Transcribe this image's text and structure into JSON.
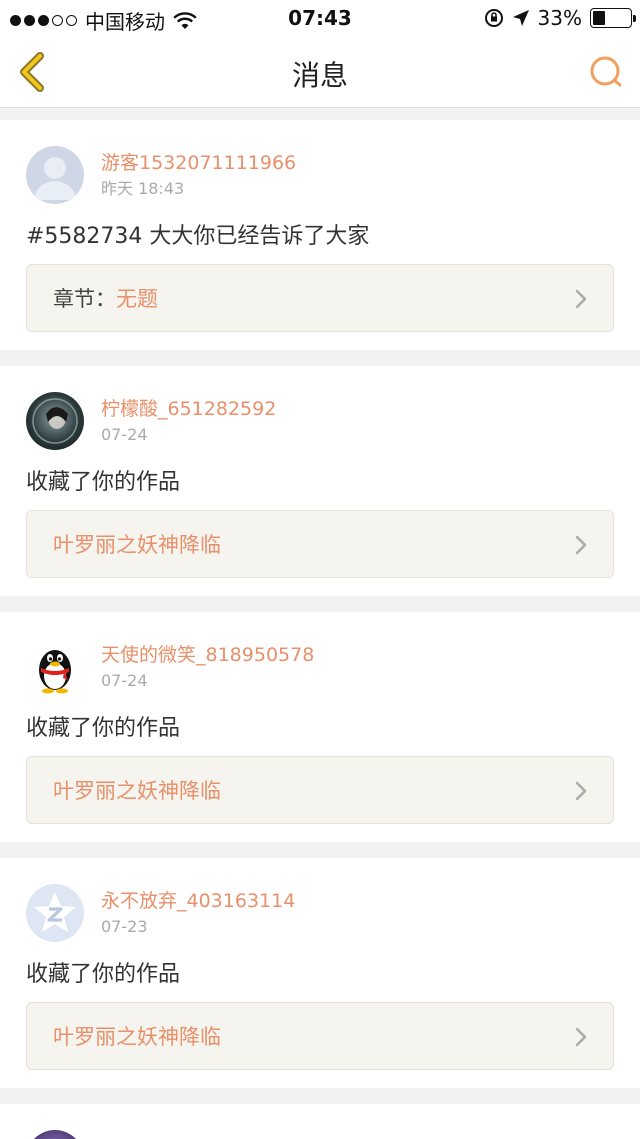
{
  "status": {
    "carrier": "中国移动",
    "time": "07:43",
    "battery": "33%",
    "battery_level": 0.33
  },
  "nav": {
    "title": "消息",
    "back_icon": "chevron-left-icon",
    "search_icon": "search-icon",
    "accent_color": "#e8906a"
  },
  "messages": [
    {
      "username": "游客1532071111966",
      "time": "昨天 18:43",
      "content": "#5582734 大大你已经告诉了大家",
      "work_label": "章节：",
      "work_title": "无题",
      "avatar": "default-user-avatar"
    },
    {
      "username": "柠檬酸_651282592",
      "time": "07-24",
      "content": "收藏了你的作品",
      "work_label": "",
      "work_title": "叶罗丽之妖神降临",
      "avatar": "photo-avatar"
    },
    {
      "username": "天使的微笑_818950578",
      "time": "07-24",
      "content": "收藏了你的作品",
      "work_label": "",
      "work_title": "叶罗丽之妖神降临",
      "avatar": "qq-penguin-avatar"
    },
    {
      "username": "永不放弃_403163114",
      "time": "07-23",
      "content": "收藏了你的作品",
      "work_label": "",
      "work_title": "叶罗丽之妖神降临",
      "avatar": "qzone-star-avatar"
    }
  ]
}
